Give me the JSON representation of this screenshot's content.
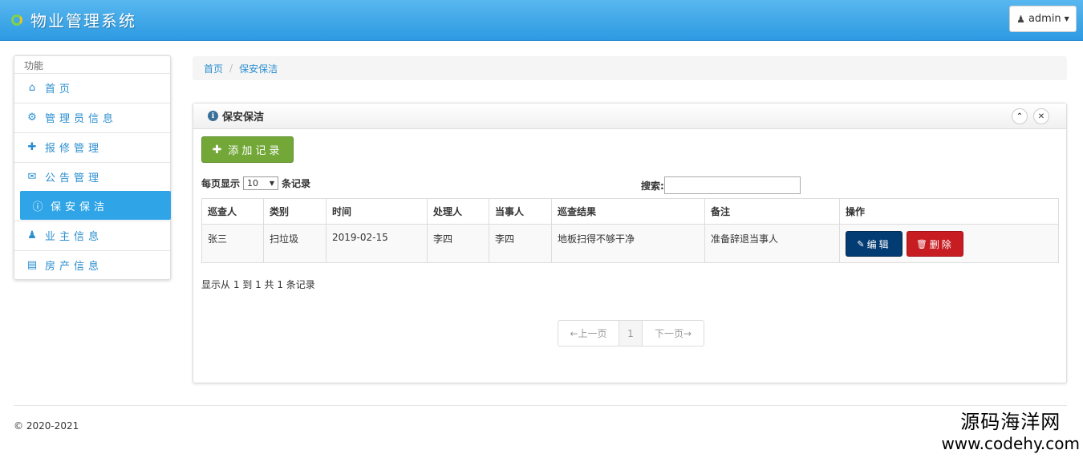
{
  "app": {
    "title": "物业管理系统",
    "user_label": "admin"
  },
  "sidebar": {
    "heading": "功能",
    "items": [
      {
        "label": "首页",
        "icon": "home-icon"
      },
      {
        "label": "管理员信息",
        "icon": "gear-icon"
      },
      {
        "label": "报修管理",
        "icon": "wrench-icon"
      },
      {
        "label": "公告管理",
        "icon": "envelope-icon"
      },
      {
        "label": "保安保洁",
        "icon": "info-icon",
        "active": true
      },
      {
        "label": "业主信息",
        "icon": "user-icon"
      },
      {
        "label": "房产信息",
        "icon": "list-icon"
      }
    ]
  },
  "breadcrumb": {
    "home": "首页",
    "current": "保安保洁"
  },
  "panel": {
    "title": "保安保洁",
    "add_label": "添加记录",
    "perpage_prefix": "每页显示",
    "perpage_value": "10",
    "perpage_suffix": "条记录",
    "search_label": "搜索:",
    "search_value": ""
  },
  "table": {
    "headers": [
      "巡查人",
      "类别",
      "时间",
      "处理人",
      "当事人",
      "巡查结果",
      "备注",
      "操作"
    ],
    "rows": [
      {
        "inspector": "张三",
        "category": "扫垃圾",
        "time": "2019-02-15",
        "handler": "李四",
        "party": "李四",
        "result": "地板扫得不够干净",
        "remark": "准备辞退当事人",
        "edit_label": "编辑",
        "delete_label": "删除"
      }
    ]
  },
  "info_text": "显示从 1 到 1 共 1 条记录",
  "pager": {
    "prev": "←上一页",
    "page": "1",
    "next": "下一页→"
  },
  "footer": "© 2020-2021",
  "watermark": {
    "line1": "源码海洋网",
    "line2": "www.codehy.com"
  },
  "colors": {
    "navbar": "#2fa4e7",
    "active": "#2fa4e7",
    "add": "#73a839",
    "edit": "#033c73",
    "delete": "#c71c22"
  }
}
